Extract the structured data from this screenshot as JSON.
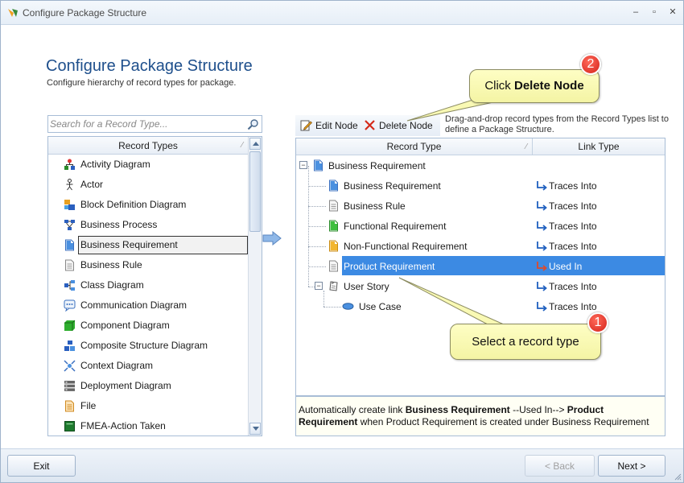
{
  "window": {
    "title": "Configure Package Structure",
    "controls": {
      "minimize": "–",
      "maximize": "▫",
      "close": "✕"
    }
  },
  "header": {
    "title": "Configure Package Structure",
    "subtitle": "Configure hierarchy of record types for package."
  },
  "search": {
    "placeholder": "Search for a Record Type..."
  },
  "record_types": {
    "header": "Record Types",
    "items": [
      {
        "label": "Activity Diagram",
        "icon": "activity-diagram-icon"
      },
      {
        "label": "Actor",
        "icon": "actor-icon"
      },
      {
        "label": "Block Definition Diagram",
        "icon": "block-definition-diagram-icon"
      },
      {
        "label": "Business Process",
        "icon": "business-process-icon"
      },
      {
        "label": "Business Requirement",
        "icon": "business-requirement-icon",
        "selected": true
      },
      {
        "label": "Business Rule",
        "icon": "business-rule-icon"
      },
      {
        "label": "Class Diagram",
        "icon": "class-diagram-icon"
      },
      {
        "label": "Communication Diagram",
        "icon": "communication-diagram-icon"
      },
      {
        "label": "Component Diagram",
        "icon": "component-diagram-icon"
      },
      {
        "label": "Composite Structure Diagram",
        "icon": "composite-structure-diagram-icon"
      },
      {
        "label": "Context Diagram",
        "icon": "context-diagram-icon"
      },
      {
        "label": "Deployment Diagram",
        "icon": "deployment-diagram-icon"
      },
      {
        "label": "File",
        "icon": "file-icon"
      },
      {
        "label": "FMEA-Action Taken",
        "icon": "fmea-action-taken-icon"
      }
    ]
  },
  "toolbar": {
    "edit_node": "Edit Node",
    "delete_node": "Delete Node"
  },
  "hint": "Drag-and-drop record types from the Record Types list to define a Package Structure.",
  "structure": {
    "col_record_type": "Record Type",
    "col_link_type": "Link Type",
    "rows": [
      {
        "label": "Business Requirement",
        "link": ""
      },
      {
        "label": "Business Requirement",
        "link": "Traces Into"
      },
      {
        "label": "Business Rule",
        "link": "Traces Into"
      },
      {
        "label": "Functional Requirement",
        "link": "Traces Into"
      },
      {
        "label": "Non-Functional Requirement",
        "link": "Traces Into"
      },
      {
        "label": "Product Requirement",
        "link": "Used In",
        "selected": true
      },
      {
        "label": "User Story",
        "link": "Traces Into"
      },
      {
        "label": "Use Case",
        "link": "Traces Into"
      }
    ]
  },
  "info": {
    "prefix": "Automatically create link ",
    "source": "Business Requirement",
    "link_text": " --Used In--> ",
    "target": "Product Requirement",
    "suffix": " when Product Requirement is created under Business Requirement"
  },
  "callouts": {
    "delete": {
      "prefix": "Click ",
      "strong": "Delete Node",
      "number": "2"
    },
    "select": {
      "text": "Select a record type",
      "number": "1"
    }
  },
  "footer": {
    "exit": "Exit",
    "back": "< Back",
    "next": "Next >"
  },
  "colors": {
    "accent": "#1e4f8c",
    "selection": "#3c8ae3",
    "callout": "#fefec4",
    "badge": "#d4221a"
  }
}
